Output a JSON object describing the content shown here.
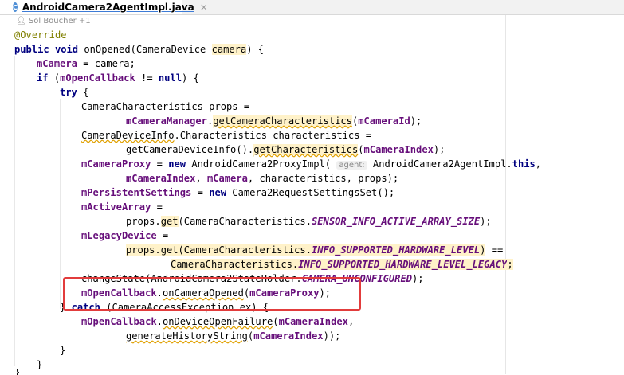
{
  "tab": {
    "icon_letter": "C",
    "filename": "AndroidCamera2AgentImpl.java",
    "close": "×"
  },
  "author": "Sol Boucher +1",
  "code": {
    "annotation": "@Override",
    "l1_a": "public void",
    "l1_b": " onOpened(CameraDevice ",
    "l1_c": "camera",
    "l1_d": ") {",
    "l2_a": "mCamera",
    "l2_b": " = camera;",
    "l3_a": "if",
    "l3_b": " (",
    "l3_c": "mOpenCallback",
    "l3_d": " != ",
    "l3_e": "null",
    "l3_f": ") {",
    "l4": "try",
    "l4_b": " {",
    "l5": "CameraCharacteristics props =",
    "l6_a": "mCameraManager",
    "l6_b": ".",
    "l6_c": "getCameraCharacteristics",
    "l6_d": "(",
    "l6_e": "mCameraId",
    "l6_f": ");",
    "l7_a": "CameraDeviceInfo",
    "l7_b": ".Characteristics characteristics =",
    "l8_a": "getCameraDeviceInfo().",
    "l8_b": "getCharacteristics",
    "l8_c": "(",
    "l8_d": "mCameraIndex",
    "l8_e": ");",
    "l9_a": "mCameraProxy",
    "l9_b": " = ",
    "l9_c": "new",
    "l9_d": " AndroidCamera2ProxyImpl( ",
    "l9_hint": "agent:",
    "l9_e": " AndroidCamera2AgentImpl.",
    "l9_f": "this",
    "l9_g": ",",
    "l10_a": "mCameraIndex",
    "l10_b": ", ",
    "l10_c": "mCamera",
    "l10_d": ", characteristics, props);",
    "l11_a": "mPersistentSettings",
    "l11_b": " = ",
    "l11_c": "new",
    "l11_d": " Camera2RequestSettingsSet();",
    "l12_a": "mActiveArray",
    "l12_b": " =",
    "l13_a": "props.",
    "l13_b": "get",
    "l13_c": "(CameraCharacteristics.",
    "l13_d": "SENSOR_INFO_ACTIVE_ARRAY_SIZE",
    "l13_e": ");",
    "l14_a": "mLegacyDevice",
    "l14_b": " =",
    "l15_a": "props.",
    "l15_b": "get",
    "l15_c": "(CameraCharacteristics.",
    "l15_d": "INFO_SUPPORTED_HARDWARE_LEVEL",
    "l15_e": ")",
    "l15_f": " ==",
    "l16_a": "CameraCharacteristics.",
    "l16_b": "INFO_SUPPORTED_HARDWARE_LEVEL_LEGACY",
    "l16_c": ";",
    "l17_a": "changeState(AndroidCamera2StateHolder.",
    "l17_b": "CAMERA_UNCONFIGURED",
    "l17_c": ");",
    "l18_a": "mOpenCallback",
    "l18_b": ".",
    "l18_c": "onCameraOpened",
    "l18_d": "(",
    "l18_e": "mCameraProxy",
    "l18_f": ");",
    "l19_a": "} ",
    "l19_b": "catch",
    "l19_c": " (CameraAccessException ex) {",
    "l20_a": "mOpenCallback",
    "l20_b": ".",
    "l20_c": "onDeviceOpenFailure",
    "l20_d": "(",
    "l20_e": "mCameraIndex",
    "l20_f": ",",
    "l21_a": "generateHistoryString",
    "l21_b": "(",
    "l21_c": "mCameraIndex",
    "l21_d": "));",
    "l22": "}",
    "l23": "}",
    "l24": "}"
  }
}
